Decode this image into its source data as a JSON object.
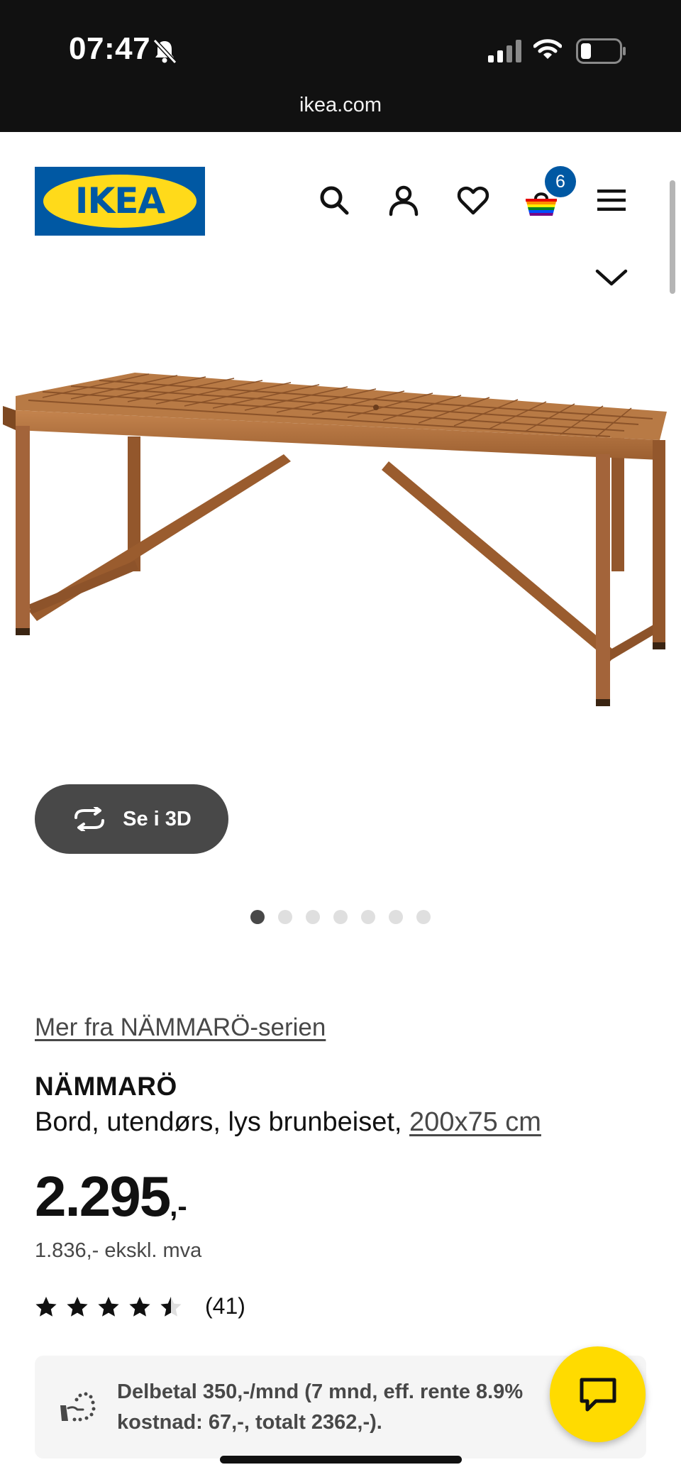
{
  "status_bar": {
    "time": "07:47",
    "url": "ikea.com",
    "icons": [
      "bell-muted-icon",
      "signal-icon",
      "wifi-icon",
      "battery-icon"
    ]
  },
  "header": {
    "logo_text": "IKEA",
    "icons": [
      "search-icon",
      "user-icon",
      "heart-icon",
      "basket-icon",
      "menu-icon",
      "chevron-down-icon"
    ],
    "cart_count": "6",
    "colors": {
      "brand_blue": "#0058a3",
      "brand_yellow": "#ffda1a"
    }
  },
  "gallery": {
    "view_3d_label": "Se i 3D",
    "dot_count": 7,
    "active_dot_index": 0
  },
  "product": {
    "series_link": "Mer fra NÄMMARÖ-serien",
    "name": "NÄMMARÖ",
    "description": "Bord, utendørs, lys brunbeiset,",
    "dimension": "200x75 cm",
    "price_integer": "2.295",
    "price_suffix": ",-",
    "price_ex_vat": "1.836,- ekskl. mva",
    "rating": 4.5,
    "review_count": "(41)"
  },
  "finance": {
    "text": "Delbetal 350,-/mnd (7 mnd, eff. rente 8.9%\nkostnad: 67,-, totalt 2362,-)."
  },
  "chat": {
    "icon": "chat-icon",
    "color": "#ffdb00"
  }
}
